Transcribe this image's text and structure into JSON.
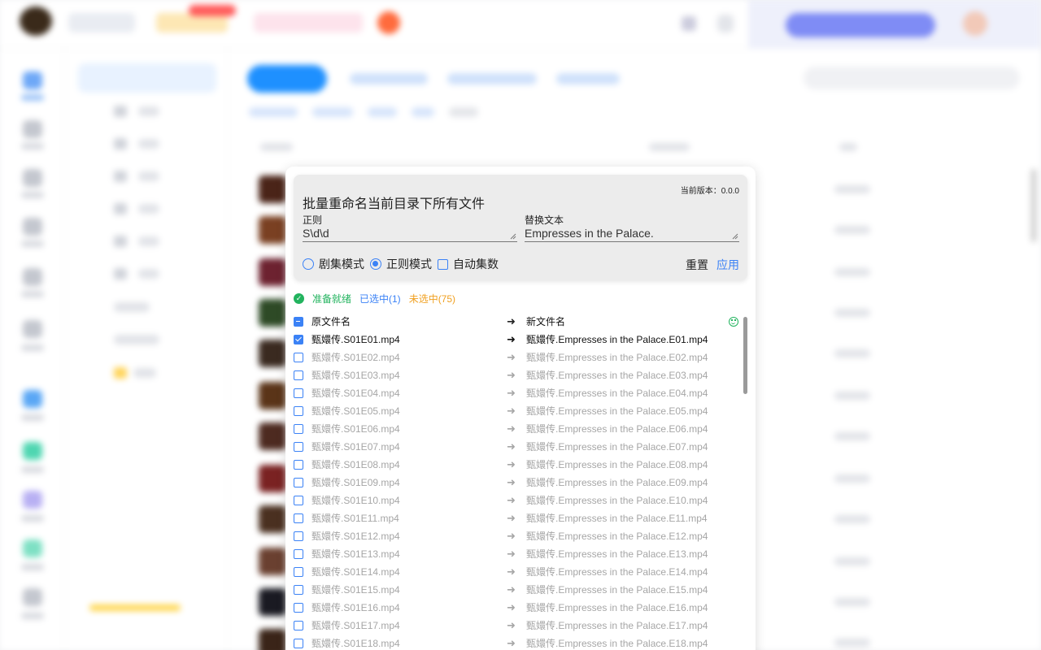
{
  "dialog": {
    "title": "批量重命名当前目录下所有文件",
    "version_label": "当前版本：0.0.0",
    "regex_label": "正则",
    "regex_value": "S\\d\\d",
    "replace_label": "替换文本",
    "replace_value": "Empresses in the Palace.",
    "modes": {
      "episode_mode": "剧集模式",
      "regex_mode": "正则模式",
      "auto_episode": "自动集数",
      "selected": "正则模式"
    },
    "reset_label": "重置",
    "apply_label": "应用",
    "status": {
      "ready": "准备就绪",
      "selected": "已选中(1)",
      "unselected": "未选中(75)"
    },
    "columns": {
      "original": "原文件名",
      "new": "新文件名"
    },
    "colors": {
      "accent": "#3b82f6",
      "ready": "#22b35e",
      "unselected": "#f0a020"
    },
    "files": [
      {
        "original": "甄嬛传.S01E01.mp4",
        "new": "甄嬛传.Empresses in the Palace.E01.mp4",
        "checked": true
      },
      {
        "original": "甄嬛传.S01E02.mp4",
        "new": "甄嬛传.Empresses in the Palace.E02.mp4",
        "checked": false
      },
      {
        "original": "甄嬛传.S01E03.mp4",
        "new": "甄嬛传.Empresses in the Palace.E03.mp4",
        "checked": false
      },
      {
        "original": "甄嬛传.S01E04.mp4",
        "new": "甄嬛传.Empresses in the Palace.E04.mp4",
        "checked": false
      },
      {
        "original": "甄嬛传.S01E05.mp4",
        "new": "甄嬛传.Empresses in the Palace.E05.mp4",
        "checked": false
      },
      {
        "original": "甄嬛传.S01E06.mp4",
        "new": "甄嬛传.Empresses in the Palace.E06.mp4",
        "checked": false
      },
      {
        "original": "甄嬛传.S01E07.mp4",
        "new": "甄嬛传.Empresses in the Palace.E07.mp4",
        "checked": false
      },
      {
        "original": "甄嬛传.S01E08.mp4",
        "new": "甄嬛传.Empresses in the Palace.E08.mp4",
        "checked": false
      },
      {
        "original": "甄嬛传.S01E09.mp4",
        "new": "甄嬛传.Empresses in the Palace.E09.mp4",
        "checked": false
      },
      {
        "original": "甄嬛传.S01E10.mp4",
        "new": "甄嬛传.Empresses in the Palace.E10.mp4",
        "checked": false
      },
      {
        "original": "甄嬛传.S01E11.mp4",
        "new": "甄嬛传.Empresses in the Palace.E11.mp4",
        "checked": false
      },
      {
        "original": "甄嬛传.S01E12.mp4",
        "new": "甄嬛传.Empresses in the Palace.E12.mp4",
        "checked": false
      },
      {
        "original": "甄嬛传.S01E13.mp4",
        "new": "甄嬛传.Empresses in the Palace.E13.mp4",
        "checked": false
      },
      {
        "original": "甄嬛传.S01E14.mp4",
        "new": "甄嬛传.Empresses in the Palace.E14.mp4",
        "checked": false
      },
      {
        "original": "甄嬛传.S01E15.mp4",
        "new": "甄嬛传.Empresses in the Palace.E15.mp4",
        "checked": false
      },
      {
        "original": "甄嬛传.S01E16.mp4",
        "new": "甄嬛传.Empresses in the Palace.E16.mp4",
        "checked": false
      },
      {
        "original": "甄嬛传.S01E17.mp4",
        "new": "甄嬛传.Empresses in the Palace.E17.mp4",
        "checked": false
      },
      {
        "original": "甄嬛传.S01E18.mp4",
        "new": "甄嬛传.Empresses in the Palace.E18.mp4",
        "checked": false
      }
    ]
  }
}
